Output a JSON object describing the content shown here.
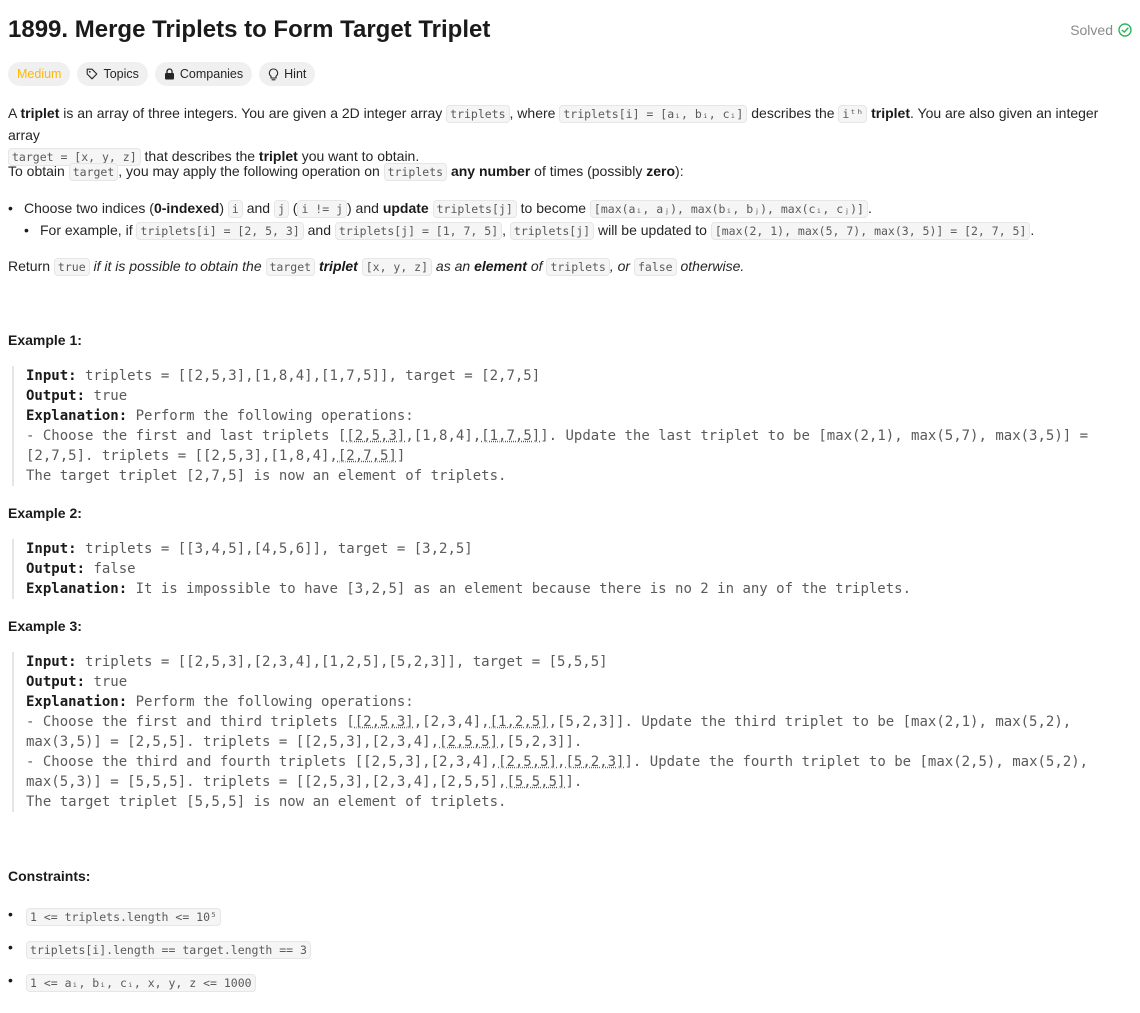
{
  "problem": {
    "title": "1899. Merge Triplets to Form Target Triplet",
    "solved_label": "Solved",
    "tags": {
      "difficulty": "Medium",
      "topics": "Topics",
      "companies": "Companies",
      "hint": "Hint"
    },
    "colors": {
      "medium": "#ffb800",
      "solved_check": "#2db55d"
    },
    "icons": {
      "topics": "tag-icon",
      "companies": "lock-icon",
      "hint": "lightbulb-icon",
      "solved": "check-circle-icon"
    }
  },
  "description": {
    "p1_a": "A ",
    "p1_triplet": "triplet",
    "p1_b": " is an array of three integers. You are given a 2D integer array ",
    "p1_triplets_code": "triplets",
    "p1_c": ", where ",
    "p1_code2": "triplets[i] = [aᵢ, bᵢ, cᵢ]",
    "p1_d": " describes the ",
    "p1_ith": "iᵗʰ",
    "p1_triplet2": "triplet",
    "p1_e": ". You are also given an integer array",
    "p1_target_code": "target = [x, y, z]",
    "p1_f": " that describes the ",
    "p1_triplet3": "triplet",
    "p1_g": " you want to obtain.",
    "p2_a": "To obtain ",
    "p2_target": "target",
    "p2_b": ", you may apply the following operation on ",
    "p2_triplets": "triplets",
    "p2_any": "any number",
    "p2_c": " of times (possibly ",
    "p2_zero": "zero",
    "p2_d": "):",
    "b1_a": "Choose two indices (",
    "b1_idx": "0-indexed",
    "b1_b": ") ",
    "b1_i": "i",
    "b1_and": " and ",
    "b1_j": "j",
    "b1_c": " (",
    "b1_neq": "i != j",
    "b1_d": ") and ",
    "b1_update": "update",
    "b1_e": " ",
    "b1_tj": "triplets[j]",
    "b1_f": " to become ",
    "b1_max": "[max(aᵢ, aⱼ), max(bᵢ, bⱼ), max(cᵢ, cⱼ)]",
    "b1_g": ".",
    "b2_a": "For example, if ",
    "b2_ti": "triplets[i] = [2, 5, 3]",
    "b2_and": " and ",
    "b2_tj": "triplets[j] = [1, 7, 5]",
    "b2_b": ", ",
    "b2_tj2": "triplets[j]",
    "b2_c": " will be updated to ",
    "b2_res": "[max(2, 1), max(5, 7), max(3, 5)] = [2, 7, 5]",
    "b2_d": ".",
    "r_a": "Return ",
    "r_true": "true",
    "r_b": " if it is possible to obtain the ",
    "r_target": "target",
    "r_c": " ",
    "r_triplet": "triplet",
    "r_d": " ",
    "r_xyz": "[x, y, z]",
    "r_e": " as an ",
    "r_element": "element",
    "r_f": " of ",
    "r_triplets": "triplets",
    "r_g": ", or ",
    "r_false": "false",
    "r_h": " otherwise."
  },
  "examples": [
    {
      "heading": "Example 1:",
      "input_label": "Input:",
      "input": " triplets = [[2,5,3],[1,8,4],[1,7,5]], target = [2,7,5]",
      "output_label": "Output:",
      "output": " true",
      "expl_label": "Explanation:",
      "expl": " Perform the following operations:",
      "line1_a": "- Choose the first and last triplets [",
      "line1_u1": "[2,5,3]",
      "line1_b": ",[1,8,4],",
      "line1_u2": "[1,7,5]",
      "line1_c": "]. Update the last triplet to be [max(2,1), max(5,7), max(3,5)] =",
      "line2_a": "[2,7,5]. triplets = [[2,5,3],[1,8,4],",
      "line2_u": "[2,7,5]",
      "line2_b": "]",
      "line3": "The target triplet [2,7,5] is now an element of triplets."
    },
    {
      "heading": "Example 2:",
      "input_label": "Input:",
      "input": " triplets = [[3,4,5],[4,5,6]], target = [3,2,5]",
      "output_label": "Output:",
      "output": " false",
      "expl_label": "Explanation:",
      "expl": " It is impossible to have [3,2,5] as an element because there is no 2 in any of the triplets."
    },
    {
      "heading": "Example 3:",
      "input_label": "Input:",
      "input": " triplets = [[2,5,3],[2,3,4],[1,2,5],[5,2,3]], target = [5,5,5]",
      "output_label": "Output:",
      "output": " true",
      "expl_label": "Explanation:",
      "expl": " Perform the following operations:",
      "l1_a": "- Choose the first and third triplets [",
      "l1_u1": "[2,5,3]",
      "l1_b": ",[2,3,4],",
      "l1_u2": "[1,2,5]",
      "l1_c": ",[5,2,3]]. Update the third triplet to be [max(2,1), max(5,2),",
      "l2_a": "max(3,5)] = [2,5,5]. triplets = [[2,5,3],[2,3,4],",
      "l2_u": "[2,5,5]",
      "l2_b": ",[5,2,3]].",
      "l3_a": "- Choose the third and fourth triplets [[2,5,3],[2,3,4],",
      "l3_u1": "[2,5,5]",
      "l3_b": ",",
      "l3_u2": "[5,2,3]",
      "l3_c": "]. Update the fourth triplet to be [max(2,5), max(5,2),",
      "l4_a": "max(5,3)] = [5,5,5]. triplets = [[2,5,3],[2,3,4],[2,5,5],",
      "l4_u": "[5,5,5]",
      "l4_b": "].",
      "l5": "The target triplet [5,5,5] is now an element of triplets."
    }
  ],
  "constraints": {
    "heading": "Constraints:",
    "items": [
      "1 <= triplets.length <= 10⁵",
      "triplets[i].length == target.length == 3",
      "1 <= aᵢ, bᵢ, cᵢ, x, y, z <= 1000"
    ]
  }
}
